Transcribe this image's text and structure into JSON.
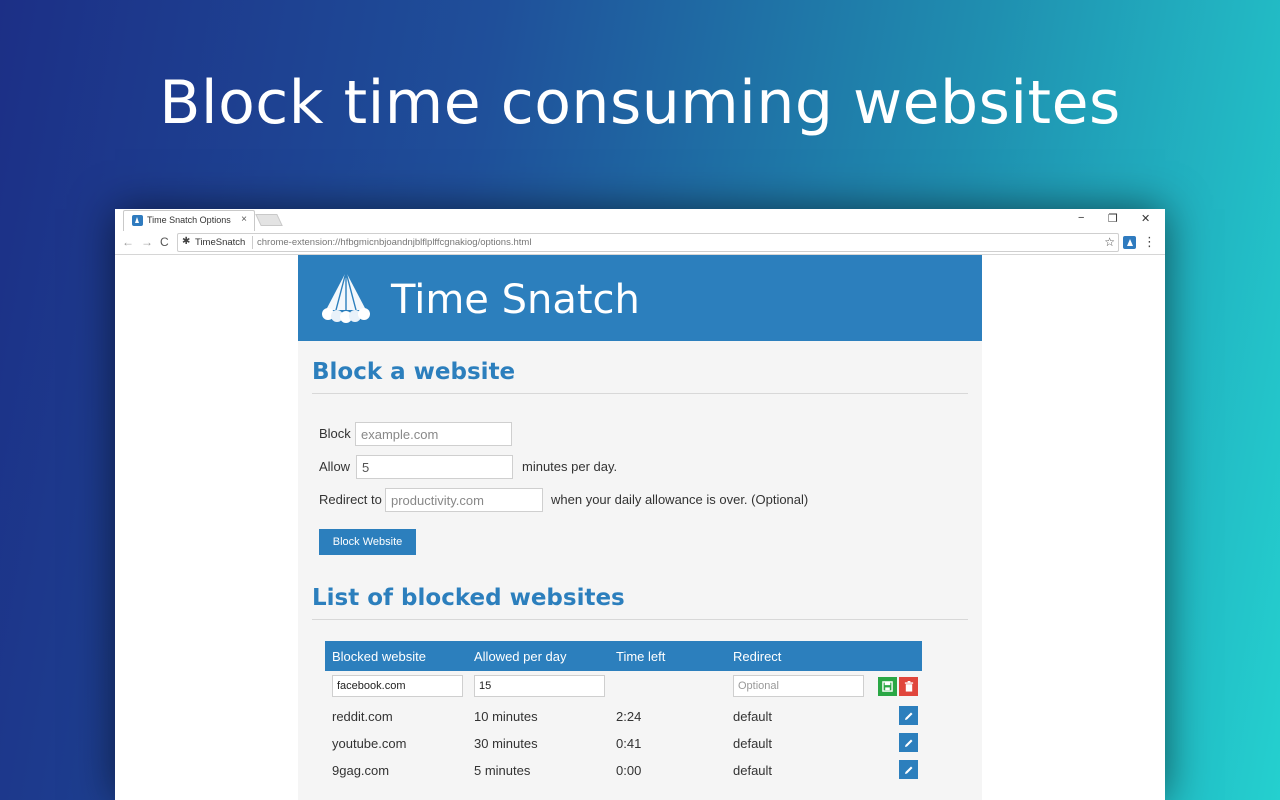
{
  "headline": "Block time consuming websites",
  "browser": {
    "tab_title": "Time Snatch Options",
    "tab_close": "×",
    "omnibox_name": "TimeSnatch",
    "url": "chrome-extension://hfbgmicnbjoandnjblflplffcgnakiog/options.html",
    "minimize": "−",
    "restore": "❐",
    "close": "✕",
    "back": "←",
    "forward": "→",
    "reload": "C",
    "star": "☆",
    "menu": "⋮"
  },
  "app": {
    "brand": "Time Snatch"
  },
  "block_form": {
    "title": "Block a website",
    "block_label": "Block",
    "block_placeholder": "example.com",
    "allow_label": "Allow",
    "allow_value": "5",
    "allow_suffix": "minutes per day.",
    "redirect_label": "Redirect to",
    "redirect_placeholder": "productivity.com",
    "redirect_suffix": "when your daily allowance is over. (Optional)",
    "submit_label": "Block Website"
  },
  "list": {
    "title": "List of blocked websites",
    "columns": [
      "Blocked website",
      "Allowed per day",
      "Time left",
      "Redirect"
    ],
    "edit_row": {
      "site": "facebook.com",
      "allowed": "15",
      "redirect_placeholder": "Optional"
    },
    "rows": [
      {
        "site": "reddit.com",
        "allowed": "10 minutes",
        "time_left": "2:24",
        "redirect": "default"
      },
      {
        "site": "youtube.com",
        "allowed": "30 minutes",
        "time_left": "0:41",
        "redirect": "default"
      },
      {
        "site": "9gag.com",
        "allowed": "5 minutes",
        "time_left": "0:00",
        "redirect": "default"
      }
    ]
  },
  "colors": {
    "accent": "#2c7fbd",
    "save": "#2aa745",
    "delete": "#e0463c"
  },
  "icons": {
    "save": "save-icon",
    "delete": "trash-icon",
    "edit": "pencil-icon"
  }
}
